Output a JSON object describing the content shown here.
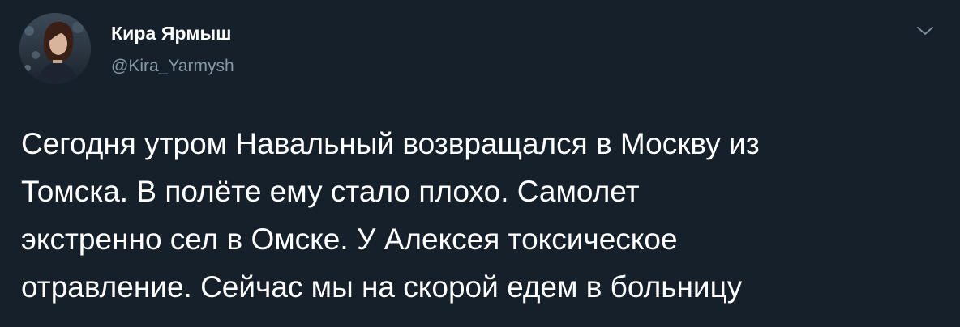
{
  "tweet": {
    "author": {
      "display_name": "Кира Ярмыш",
      "handle": "@Kira_Yarmysh",
      "avatar_icon": "profile-photo"
    },
    "menu_icon": "chevron-down-icon",
    "text_lines": [
      "Сегодня утром Навальный возвращался в Москву из",
      "Томска. В полёте ему стало плохо. Самолет",
      "экстренно сел в Омске. У Алексея токсическое",
      "отравление. Сейчас мы на скорой едем в больницу"
    ]
  },
  "colors": {
    "background": "#15202b",
    "primary_text": "#ffffff",
    "secondary_text": "#8899a6"
  }
}
